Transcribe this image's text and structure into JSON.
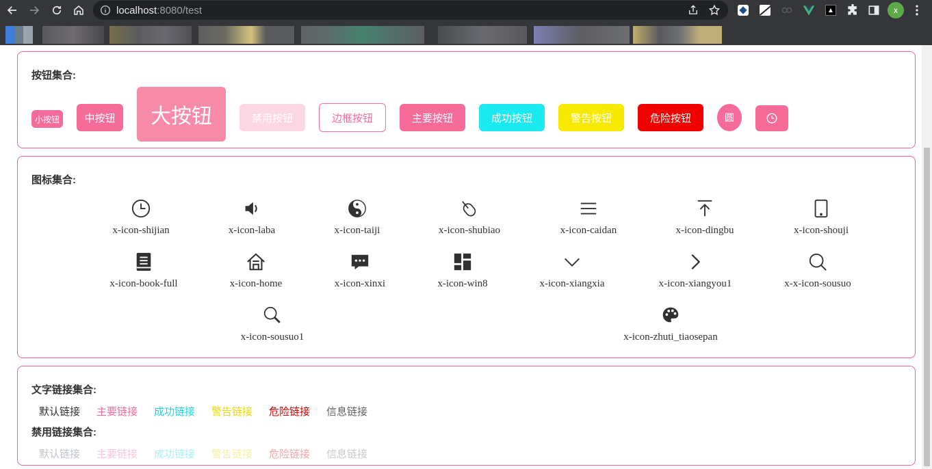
{
  "browser": {
    "url_host": "localhost",
    "url_rest": ":8080/test",
    "profile_initial": "x"
  },
  "buttons_section": {
    "title": "按钮集合:",
    "mini": "小按钮",
    "medium": "中按钮",
    "large": "大按钮",
    "disabled": "禁用按钮",
    "outline": "边框按钮",
    "primary": "主要按钮",
    "success": "成功按钮",
    "warning": "警告按钮",
    "danger": "危险按钮",
    "round": "圆"
  },
  "icons_section": {
    "title": "图标集合:",
    "icons": [
      {
        "label": "x-icon-shijian",
        "icon": "clock-icon"
      },
      {
        "label": "x-icon-laba",
        "icon": "speaker-icon"
      },
      {
        "label": "x-icon-taiji",
        "icon": "yin-yang-icon"
      },
      {
        "label": "x-icon-shubiao",
        "icon": "mouse-icon"
      },
      {
        "label": "x-icon-caidan",
        "icon": "menu-icon"
      },
      {
        "label": "x-icon-dingbu",
        "icon": "to-top-icon"
      },
      {
        "label": "x-icon-shouji",
        "icon": "phone-icon"
      },
      {
        "label": "x-icon-book-full",
        "icon": "book-icon"
      },
      {
        "label": "x-icon-home",
        "icon": "home-icon"
      },
      {
        "label": "x-icon-xinxi",
        "icon": "message-icon"
      },
      {
        "label": "x-icon-win8",
        "icon": "windows-tiles-icon"
      },
      {
        "label": "x-icon-xiangxia",
        "icon": "chevron-down-icon"
      },
      {
        "label": "x-icon-xiangyou1",
        "icon": "chevron-right-icon"
      },
      {
        "label": "x-x-icon-sousuo",
        "icon": "search-icon"
      },
      {
        "label": "x-icon-sousuo1",
        "icon": "search-alt-icon"
      },
      {
        "label": "x-icon-zhuti_tiaosepan",
        "icon": "palette-icon"
      }
    ]
  },
  "links_section": {
    "title": "文字链接集合:",
    "disabled_title": "禁用链接集合:",
    "links": [
      {
        "label": "默认链接",
        "color": "#303133",
        "disabled_color": "#c0c4cc"
      },
      {
        "label": "主要链接",
        "color": "#f56c98",
        "disabled_color": "#fbc4d6"
      },
      {
        "label": "成功链接",
        "color": "#1ad6e8",
        "disabled_color": "#a6f0f4"
      },
      {
        "label": "警告链接",
        "color": "#e8d800",
        "disabled_color": "#f7f0a6"
      },
      {
        "label": "危险链接",
        "color": "#d40000",
        "disabled_color": "#f2a6a6"
      },
      {
        "label": "信息链接",
        "color": "#606266",
        "disabled_color": "#c8c9cc"
      }
    ]
  },
  "colors": {
    "accent": "#f56c98",
    "card_border": "#f0609a"
  }
}
